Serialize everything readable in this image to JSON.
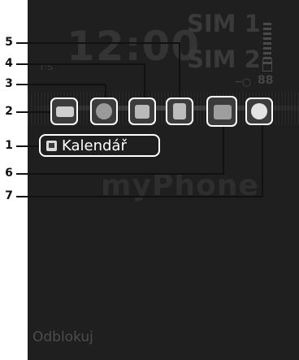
{
  "callouts": [
    "1",
    "2",
    "3",
    "4",
    "5",
    "6",
    "7"
  ],
  "status": {
    "clock": "12:00",
    "sim1": "SIM 1",
    "sim2": "SIM 2",
    "operator": "T·S",
    "key_indicator": "─○",
    "counter": "88"
  },
  "wallpaper_logo": "myPhone",
  "menu": {
    "selected_label": "Kalendář",
    "icons": [
      "envelope-icon",
      "globe-icon",
      "picture-icon",
      "document-icon",
      "folder-icon",
      "clock-icon"
    ]
  },
  "softkey_left": "Odblokuj"
}
